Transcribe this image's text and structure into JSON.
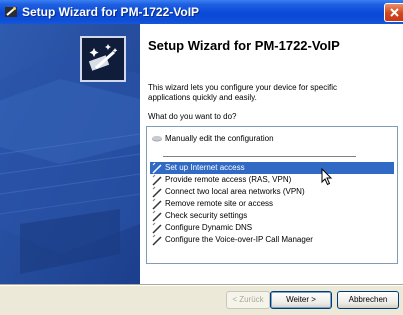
{
  "window": {
    "title": "Setup Wizard for PM-1722-VoIP",
    "close_icon": "close-icon"
  },
  "header": {
    "heading": "Setup Wizard for PM-1722-VoIP",
    "description": "This wizard lets you configure your device for specific applications quickly and easily.",
    "question": "What do you want to do?"
  },
  "options": [
    {
      "label": "Manually edit the configuration",
      "icon": "disk-icon",
      "selected": false
    },
    {
      "label": "Set up Internet access",
      "icon": "wand-icon",
      "selected": true
    },
    {
      "label": "Provide remote access (RAS, VPN)",
      "icon": "wand-icon",
      "selected": false
    },
    {
      "label": "Connect two local area networks (VPN)",
      "icon": "wand-icon",
      "selected": false
    },
    {
      "label": "Remove remote site or access",
      "icon": "wand-icon",
      "selected": false
    },
    {
      "label": "Check security settings",
      "icon": "wand-icon",
      "selected": false
    },
    {
      "label": "Configure Dynamic DNS",
      "icon": "wand-icon",
      "selected": false
    },
    {
      "label": "Configure the Voice-over-IP Call Manager",
      "icon": "wand-icon",
      "selected": false
    }
  ],
  "buttons": {
    "back": "< Zurück",
    "next": "Weiter >",
    "cancel": "Abbrechen"
  },
  "colors": {
    "titlebar": "#0a48d8",
    "selection": "#316ac5",
    "left_panel": "#254c9f"
  }
}
